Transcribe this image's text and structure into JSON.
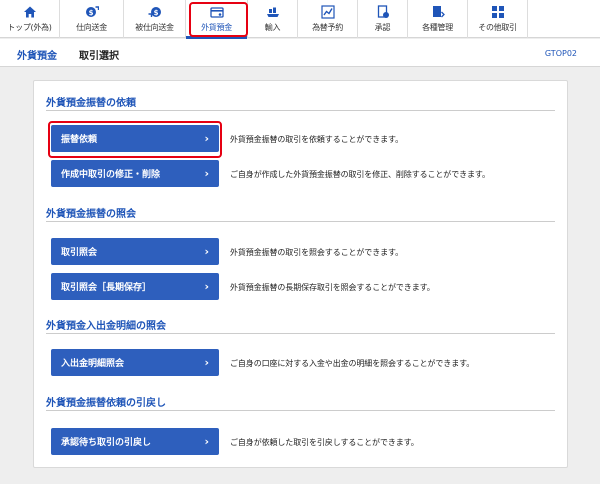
{
  "nav": {
    "items": [
      {
        "label": "トップ(外為)",
        "icon": "home-icon"
      },
      {
        "label": "仕向送金",
        "icon": "outgoing-remittance-icon"
      },
      {
        "label": "被仕向送金",
        "icon": "incoming-remittance-icon"
      },
      {
        "label": "外貨預金",
        "icon": "deposit-icon"
      },
      {
        "label": "輸入",
        "icon": "import-icon"
      },
      {
        "label": "為替予約",
        "icon": "fx-contract-icon"
      },
      {
        "label": "承認",
        "icon": "approval-icon"
      },
      {
        "label": "各種管理",
        "icon": "management-icon"
      },
      {
        "label": "その他取引",
        "icon": "other-transactions-icon"
      }
    ],
    "active_label": "外貨預金"
  },
  "header": {
    "section": "外貨預金",
    "page": "取引選択",
    "screen_code": "GTOP02"
  },
  "sections": [
    {
      "title": "外貨預金振替の依頼",
      "rows": [
        {
          "button": "振替依頼",
          "desc": "外貨預金振替の取引を依頼することができます。"
        },
        {
          "button": "作成中取引の修正・削除",
          "desc": "ご自身が作成した外貨預金振替の取引を修正、削除することができます。"
        }
      ]
    },
    {
      "title": "外貨預金振替の照会",
      "rows": [
        {
          "button": "取引照会",
          "desc": "外貨預金振替の取引を照会することができます。"
        },
        {
          "button": "取引照会［長期保存］",
          "desc": "外貨預金振替の長期保存取引を照会することができます。"
        }
      ]
    },
    {
      "title": "外貨預金入出金明細の照会",
      "rows": [
        {
          "button": "入出金明細照会",
          "desc": "ご自身の口座に対する入金や出金の明細を照会することができます。"
        }
      ]
    },
    {
      "title": "外貨預金振替依頼の引戻し",
      "rows": [
        {
          "button": "承認待ち取引の引戻し",
          "desc": "ご自身が依頼した取引を引戻しすることができます。"
        }
      ]
    }
  ],
  "chevron": "›",
  "colors": {
    "accent": "#1f55b8",
    "button": "#2e5fbd",
    "highlight": "#e60012"
  }
}
